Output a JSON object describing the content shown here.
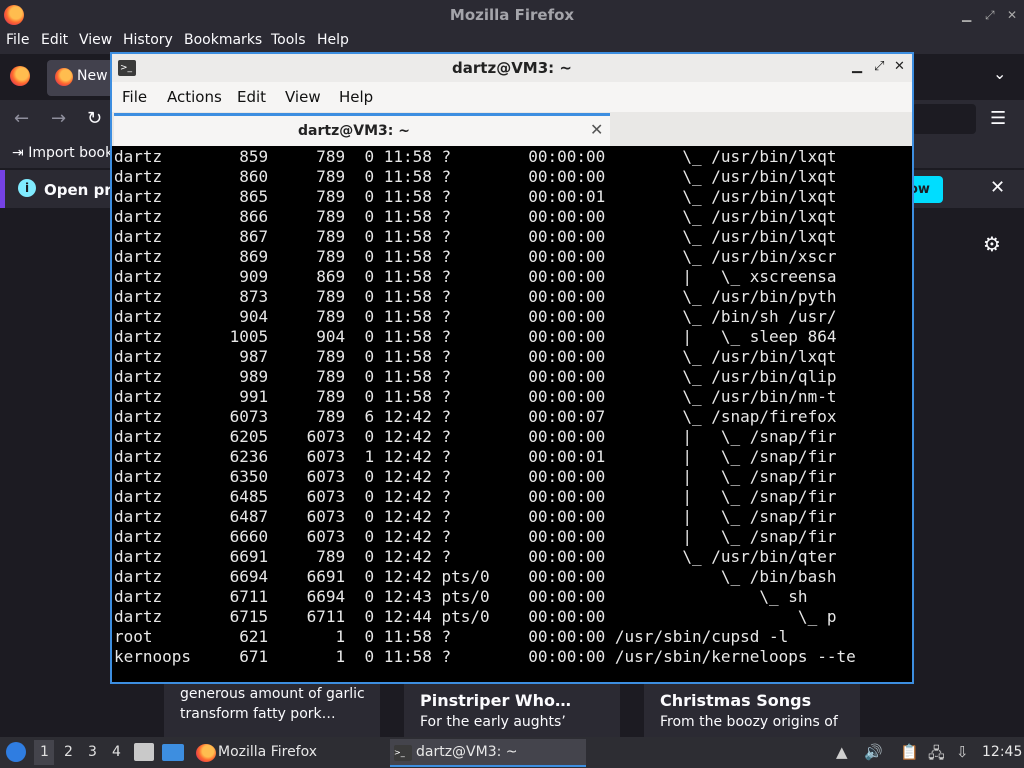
{
  "firefox": {
    "window_title": "Mozilla Firefox",
    "menu": [
      "File",
      "Edit",
      "View",
      "History",
      "Bookmarks",
      "Tools",
      "Help"
    ],
    "tab_label": "New",
    "bookmarks_import": "Import book",
    "notification_text": "Open pre",
    "notification_button": "ow",
    "cards": [
      {
        "title": "",
        "line1": "generous amount of garlic",
        "line2": "transform fatty pork…"
      },
      {
        "title": "Pinstriper Who…",
        "line1": "For the early aughts’",
        "line2": ""
      },
      {
        "title": "Christmas Songs",
        "line1": "From the boozy origins of",
        "line2": ""
      }
    ]
  },
  "terminal": {
    "window_title": "dartz@VM3: ~",
    "menu": [
      "File",
      "Actions",
      "Edit",
      "View",
      "Help"
    ],
    "tab_title": "dartz@VM3: ~",
    "processes": [
      {
        "user": "dartz",
        "pid": "859",
        "ppid": "789",
        "c": "0",
        "stime": "11:58",
        "tty": "?",
        "time": "00:00:00",
        "cmd": "       \\_ /usr/bin/lxqt"
      },
      {
        "user": "dartz",
        "pid": "860",
        "ppid": "789",
        "c": "0",
        "stime": "11:58",
        "tty": "?",
        "time": "00:00:00",
        "cmd": "       \\_ /usr/bin/lxqt"
      },
      {
        "user": "dartz",
        "pid": "865",
        "ppid": "789",
        "c": "0",
        "stime": "11:58",
        "tty": "?",
        "time": "00:00:01",
        "cmd": "       \\_ /usr/bin/lxqt"
      },
      {
        "user": "dartz",
        "pid": "866",
        "ppid": "789",
        "c": "0",
        "stime": "11:58",
        "tty": "?",
        "time": "00:00:00",
        "cmd": "       \\_ /usr/bin/lxqt"
      },
      {
        "user": "dartz",
        "pid": "867",
        "ppid": "789",
        "c": "0",
        "stime": "11:58",
        "tty": "?",
        "time": "00:00:00",
        "cmd": "       \\_ /usr/bin/lxqt"
      },
      {
        "user": "dartz",
        "pid": "869",
        "ppid": "789",
        "c": "0",
        "stime": "11:58",
        "tty": "?",
        "time": "00:00:00",
        "cmd": "       \\_ /usr/bin/xscr"
      },
      {
        "user": "dartz",
        "pid": "909",
        "ppid": "869",
        "c": "0",
        "stime": "11:58",
        "tty": "?",
        "time": "00:00:00",
        "cmd": "       |   \\_ xscreensa"
      },
      {
        "user": "dartz",
        "pid": "873",
        "ppid": "789",
        "c": "0",
        "stime": "11:58",
        "tty": "?",
        "time": "00:00:00",
        "cmd": "       \\_ /usr/bin/pyth"
      },
      {
        "user": "dartz",
        "pid": "904",
        "ppid": "789",
        "c": "0",
        "stime": "11:58",
        "tty": "?",
        "time": "00:00:00",
        "cmd": "       \\_ /bin/sh /usr/"
      },
      {
        "user": "dartz",
        "pid": "1005",
        "ppid": "904",
        "c": "0",
        "stime": "11:58",
        "tty": "?",
        "time": "00:00:00",
        "cmd": "       |   \\_ sleep 864"
      },
      {
        "user": "dartz",
        "pid": "987",
        "ppid": "789",
        "c": "0",
        "stime": "11:58",
        "tty": "?",
        "time": "00:00:00",
        "cmd": "       \\_ /usr/bin/lxqt"
      },
      {
        "user": "dartz",
        "pid": "989",
        "ppid": "789",
        "c": "0",
        "stime": "11:58",
        "tty": "?",
        "time": "00:00:00",
        "cmd": "       \\_ /usr/bin/qlip"
      },
      {
        "user": "dartz",
        "pid": "991",
        "ppid": "789",
        "c": "0",
        "stime": "11:58",
        "tty": "?",
        "time": "00:00:00",
        "cmd": "       \\_ /usr/bin/nm-t"
      },
      {
        "user": "dartz",
        "pid": "6073",
        "ppid": "789",
        "c": "6",
        "stime": "12:42",
        "tty": "?",
        "time": "00:00:07",
        "cmd": "       \\_ /snap/firefox"
      },
      {
        "user": "dartz",
        "pid": "6205",
        "ppid": "6073",
        "c": "0",
        "stime": "12:42",
        "tty": "?",
        "time": "00:00:00",
        "cmd": "       |   \\_ /snap/fir"
      },
      {
        "user": "dartz",
        "pid": "6236",
        "ppid": "6073",
        "c": "1",
        "stime": "12:42",
        "tty": "?",
        "time": "00:00:01",
        "cmd": "       |   \\_ /snap/fir"
      },
      {
        "user": "dartz",
        "pid": "6350",
        "ppid": "6073",
        "c": "0",
        "stime": "12:42",
        "tty": "?",
        "time": "00:00:00",
        "cmd": "       |   \\_ /snap/fir"
      },
      {
        "user": "dartz",
        "pid": "6485",
        "ppid": "6073",
        "c": "0",
        "stime": "12:42",
        "tty": "?",
        "time": "00:00:00",
        "cmd": "       |   \\_ /snap/fir"
      },
      {
        "user": "dartz",
        "pid": "6487",
        "ppid": "6073",
        "c": "0",
        "stime": "12:42",
        "tty": "?",
        "time": "00:00:00",
        "cmd": "       |   \\_ /snap/fir"
      },
      {
        "user": "dartz",
        "pid": "6660",
        "ppid": "6073",
        "c": "0",
        "stime": "12:42",
        "tty": "?",
        "time": "00:00:00",
        "cmd": "       |   \\_ /snap/fir"
      },
      {
        "user": "dartz",
        "pid": "6691",
        "ppid": "789",
        "c": "0",
        "stime": "12:42",
        "tty": "?",
        "time": "00:00:00",
        "cmd": "       \\_ /usr/bin/qter"
      },
      {
        "user": "dartz",
        "pid": "6694",
        "ppid": "6691",
        "c": "0",
        "stime": "12:42",
        "tty": "pts/0",
        "time": "00:00:00",
        "cmd": "           \\_ /bin/bash"
      },
      {
        "user": "dartz",
        "pid": "6711",
        "ppid": "6694",
        "c": "0",
        "stime": "12:43",
        "tty": "pts/0",
        "time": "00:00:00",
        "cmd": "               \\_ sh"
      },
      {
        "user": "dartz",
        "pid": "6715",
        "ppid": "6711",
        "c": "0",
        "stime": "12:44",
        "tty": "pts/0",
        "time": "00:00:00",
        "cmd": "                   \\_ p"
      },
      {
        "user": "root",
        "pid": "621",
        "ppid": "1",
        "c": "0",
        "stime": "11:58",
        "tty": "?",
        "time": "00:00:00",
        "cmd": "/usr/sbin/cupsd -l"
      },
      {
        "user": "kernoops",
        "pid": "671",
        "ppid": "1",
        "c": "0",
        "stime": "11:58",
        "tty": "?",
        "time": "00:00:00",
        "cmd": "/usr/sbin/kerneloops --te"
      }
    ]
  },
  "taskbar": {
    "workspaces": [
      "1",
      "2",
      "3",
      "4"
    ],
    "tasks": [
      {
        "label": "Mozilla Firefox",
        "icon": "firefox-icon"
      },
      {
        "label": "dartz@VM3: ~",
        "icon": "terminal-icon"
      }
    ],
    "clock": "12:45"
  },
  "colors": {
    "accent": "#3d8ee0",
    "firefox_dark": "#1c1b22",
    "notification_button": "#00ddff"
  }
}
